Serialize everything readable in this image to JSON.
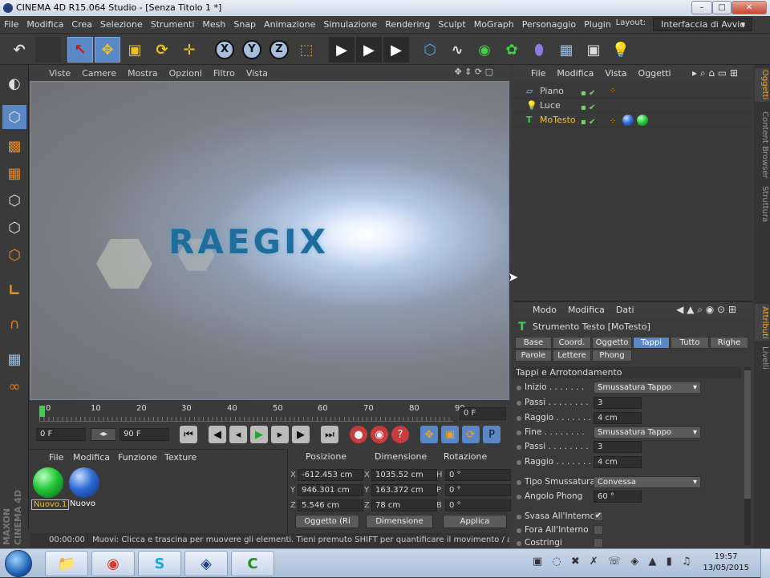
{
  "window": {
    "title": "CINEMA 4D R15.064 Studio - [Senza Titolo 1 *]",
    "min": "–",
    "max": "□",
    "close": "✕"
  },
  "menubar": {
    "items": [
      "File",
      "Modifica",
      "Crea",
      "Selezione",
      "Strumenti",
      "Mesh",
      "Snap",
      "Animazione",
      "Simulazione",
      "Rendering",
      "Sculpt",
      "MoGraph",
      "Personaggio",
      "Plugin"
    ],
    "layout_label": "Layout:",
    "layout_value": "Interfaccia di Avvio"
  },
  "toolbar": {
    "undo": "↶",
    "live_select": "↖",
    "move": "✥",
    "scale": "▣",
    "rotate": "⟳",
    "add": "✛",
    "x": "X",
    "y": "Y",
    "z": "Z",
    "coord": "⬚",
    "render_view": "▶",
    "render_pic": "▶",
    "render_settings": "▶",
    "cube": "⬡",
    "spline": "∿",
    "nurbs": "◉",
    "array": "✿",
    "deformer": "⬮",
    "floor": "▦",
    "camera": "▣",
    "light": "💡"
  },
  "viewport": {
    "menu": [
      "Viste",
      "Camere",
      "Mostra",
      "Opzioni",
      "Filtro",
      "Vista"
    ],
    "logo_text": "RAEGIX"
  },
  "timeline": {
    "ticks": [
      "0",
      "10",
      "20",
      "30",
      "40",
      "50",
      "60",
      "70",
      "80",
      "90"
    ],
    "end_frame": "0 F",
    "start_field": "0 F",
    "end_field": "90 F",
    "current_label": "0 F"
  },
  "material_manager": {
    "menu": [
      "File",
      "Modifica",
      "Funzione",
      "Texture"
    ],
    "materials": [
      {
        "name": "Nuovo.1",
        "color": "#22c838"
      },
      {
        "name": "Nuovo",
        "color": "#2f6bd6"
      }
    ]
  },
  "coordinates": {
    "headers": [
      "Posizione",
      "Dimensione",
      "Rotazione"
    ],
    "rows": [
      {
        "pos_axis": "X",
        "pos": "-612.453 cm",
        "dim_axis": "X",
        "dim": "1035.52 cm",
        "rot_axis": "H",
        "rot": "0 °"
      },
      {
        "pos_axis": "Y",
        "pos": "946.301 cm",
        "dim_axis": "Y",
        "dim": "163.372 cm",
        "rot_axis": "P",
        "rot": "0 °"
      },
      {
        "pos_axis": "Z",
        "pos": "5.546 cm",
        "dim_axis": "Z",
        "dim": "78 cm",
        "rot_axis": "B",
        "rot": "0 °"
      }
    ],
    "mode_button": "Oggetto (Ri",
    "dim_button": "Dimensione",
    "apply_button": "Applica"
  },
  "status": {
    "time": "00:00:00",
    "text": "Muovi: Clicca e trascina per muovere gli elementi. Tieni premuto SHIFT per quantificare il movimento / aggiu"
  },
  "object_manager": {
    "menu": [
      "File",
      "Modifica",
      "Vista",
      "Oggetti"
    ],
    "objects": [
      {
        "name": "Piano",
        "color": "#d0d0d0"
      },
      {
        "name": "Luce",
        "color": "#d0d0d0"
      },
      {
        "name": "MoTesto",
        "color": "#f0c040"
      }
    ]
  },
  "side_tabs": {
    "top": [
      "Oggetti",
      "Content Browser",
      "Struttura"
    ],
    "bottom": [
      "Attributi",
      "Livelli"
    ]
  },
  "attributes": {
    "menu": [
      "Modo",
      "Modifica",
      "Dati"
    ],
    "title": "Strumento Testo [MoTesto]",
    "tabs_row1": [
      "Base",
      "Coord.",
      "Oggetto",
      "Tappi",
      "Tutto",
      "Righe"
    ],
    "tabs_row2": [
      "Parole",
      "Lettere",
      "Phong"
    ],
    "active_tab": "Tappi",
    "section": "Tappi e Arrotondamento",
    "props": [
      {
        "label": "Inizio . . . . . . .",
        "type": "drop",
        "value": "Smussatura Tappo"
      },
      {
        "label": "Passi . . . . . . . .",
        "type": "num",
        "value": "3"
      },
      {
        "label": "Raggio . . . . . . .",
        "type": "num",
        "value": "4 cm"
      },
      {
        "label": "Fine . . . . . . . .",
        "type": "drop",
        "value": "Smussatura Tappo"
      },
      {
        "label": "Passi . . . . . . . .",
        "type": "num",
        "value": "3"
      },
      {
        "label": "Raggio . . . . . . .",
        "type": "num",
        "value": "4 cm"
      },
      {
        "label": "Tipo Smussatura",
        "type": "drop",
        "value": "Convessa"
      },
      {
        "label": "Angolo Phong",
        "type": "num",
        "value": "60 °"
      },
      {
        "label": "Svasa All'Interno",
        "type": "chk",
        "value": "✔"
      },
      {
        "label": "Fora All'Interno",
        "type": "chk",
        "value": ""
      },
      {
        "label": "Costringi",
        "type": "chk",
        "value": ""
      }
    ]
  },
  "taskbar": {
    "clock_time": "19:57",
    "clock_date": "13/05/2015",
    "apps": [
      "📁",
      "◉",
      "S",
      "◈",
      "C"
    ]
  }
}
